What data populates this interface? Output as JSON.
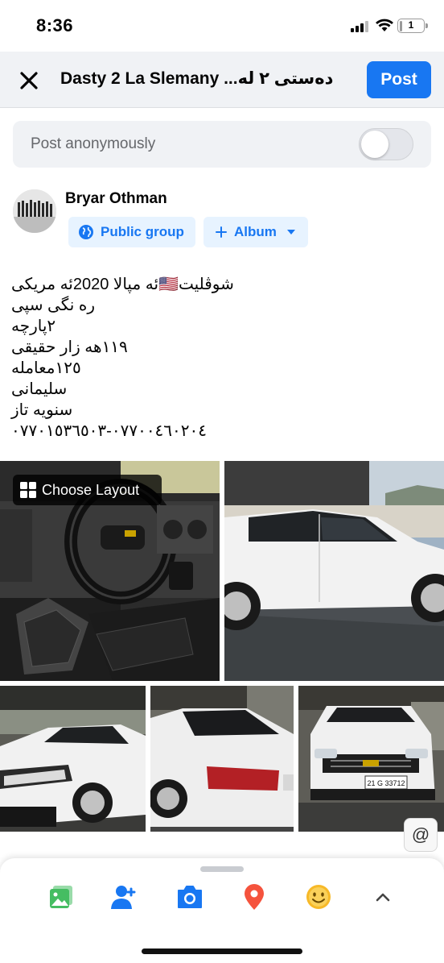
{
  "status_bar": {
    "time": "8:36",
    "battery_level": "1",
    "battery_fraction": 0.1
  },
  "header": {
    "title": "Dasty  2  La Slemany ...دەستی ٢ لە",
    "post_label": "Post"
  },
  "anonymous": {
    "label": "Post anonymously",
    "enabled": false
  },
  "author": {
    "name": "Bryar Othman",
    "audience_label": "Public group",
    "album_label": "Album"
  },
  "post": {
    "lines": [
      "شوڤليت🇺🇸ئه مپالا 2020ئه مريكی",
      "ره نگی سپی",
      "٢پارچه",
      "١١٩هه زار حقيقی",
      "١٢٥معامله",
      "سليمانی",
      "سنويه تاز",
      "٠٧٧٠٠٤٦٠٢٠٤-٠٧٧٠١٥٣٦٥٠٣"
    ]
  },
  "photos": {
    "layout_label": "Choose Layout",
    "plate_text": "21 G 33712"
  },
  "composer_tools": [
    "photo-icon",
    "tag-people-icon",
    "camera-icon",
    "location-icon",
    "feeling-icon",
    "expand-icon"
  ],
  "colors": {
    "brand": "#1877f2",
    "photo": "#45bd62",
    "location": "#f5533d",
    "feeling": "#f7b928",
    "panel": "#f0f2f5"
  }
}
